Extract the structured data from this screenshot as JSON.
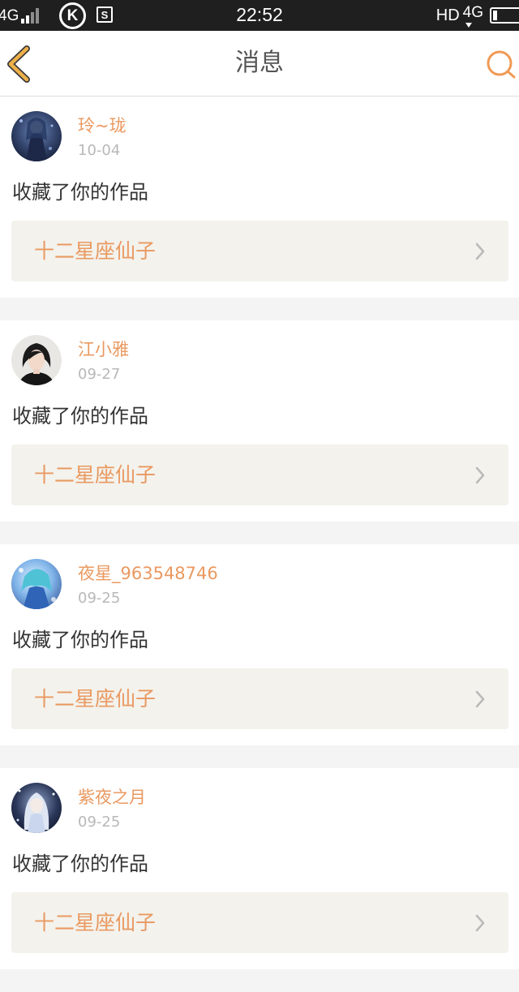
{
  "status_bar": {
    "network_left": "4G",
    "k_badge": "K",
    "s_badge": "S",
    "time": "22:52",
    "hd": "HD",
    "network_right": "4G"
  },
  "nav": {
    "title": "消息",
    "back_icon": "chevron-left-icon",
    "search_icon": "search-icon",
    "accent_color": "#eeb04a",
    "search_color": "#f09a55"
  },
  "messages": [
    {
      "user": "玲~珑",
      "date": "10-04",
      "text": "收藏了你的作品",
      "work": "十二星座仙子"
    },
    {
      "user": "江小雅",
      "date": "09-27",
      "text": "收藏了你的作品",
      "work": "十二星座仙子"
    },
    {
      "user": "夜星_963548746",
      "date": "09-25",
      "text": "收藏了你的作品",
      "work": "十二星座仙子"
    },
    {
      "user": "紫夜之月",
      "date": "09-25",
      "text": "收藏了你的作品",
      "work": "十二星座仙子"
    }
  ],
  "colors": {
    "name_color": "#ea9960",
    "date_color": "#b8b8b8",
    "work_box_bg": "#f3f2ed"
  }
}
